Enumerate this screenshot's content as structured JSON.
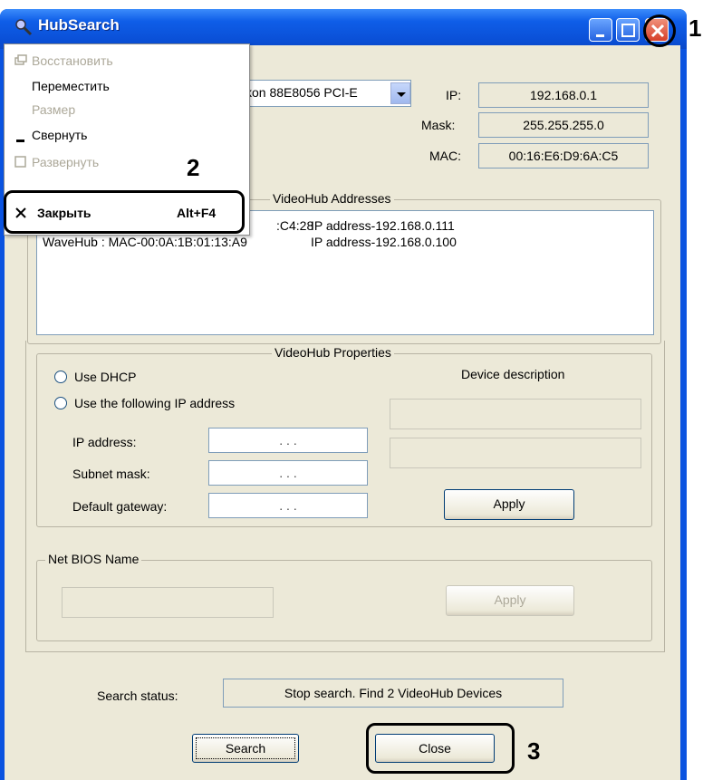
{
  "window": {
    "title": "HubSearch"
  },
  "network": {
    "adapter_value": "kon 88E8056 PCI-E",
    "ip_label": "IP:",
    "ip_value": "192.168.0.1",
    "mask_label": "Mask:",
    "mask_value": "255.255.255.0",
    "mac_label": "MAC:",
    "mac_value": "00:16:E6:D9:6A:C5"
  },
  "addresses": {
    "legend": "VideoHub Addresses",
    "items": [
      {
        "device": ":C4:28",
        "ip": "IP address-192.168.0.111"
      },
      {
        "device": "WaveHub : MAC-00:0A:1B:01:13:A9",
        "ip": "IP address-192.168.0.100"
      }
    ]
  },
  "properties": {
    "legend": "VideoHub Properties",
    "use_dhcp": "Use DHCP",
    "use_static": "Use the following IP address",
    "ip_label": "IP address:",
    "subnet_label": "Subnet mask:",
    "gateway_label": "Default gateway:",
    "ip_placeholder": ". . .",
    "description_label": "Device description",
    "apply": "Apply"
  },
  "netbios": {
    "legend": "Net BIOS Name",
    "apply": "Apply"
  },
  "search": {
    "status_label": "Search status:",
    "status_value": "Stop search. Find 2 VideoHub Devices",
    "search_button": "Search",
    "close_button": "Close"
  },
  "context_menu": {
    "items": [
      {
        "label": "Восстановить",
        "disabled": true
      },
      {
        "label": "Переместить",
        "disabled": false
      },
      {
        "label": "Размер",
        "disabled": true
      },
      {
        "label": "Свернуть",
        "disabled": false
      },
      {
        "label": "Развернуть",
        "disabled": true
      },
      {
        "label": "Закрыть",
        "shortcut": "Alt+F4",
        "disabled": false,
        "bold": true
      }
    ]
  },
  "annotations": {
    "one": "1",
    "two": "2",
    "three": "3"
  }
}
